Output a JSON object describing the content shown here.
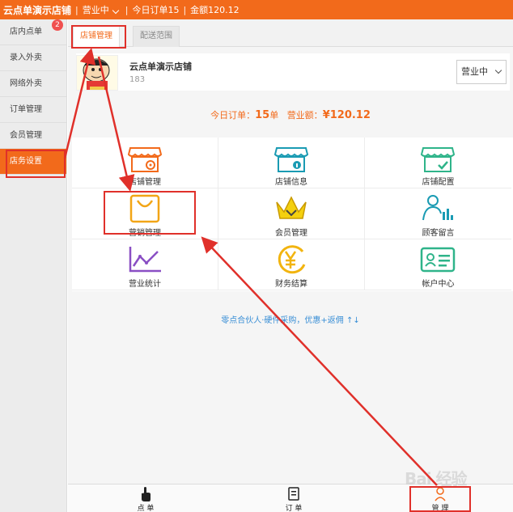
{
  "topbar": {
    "store_name": "云点单演示店铺",
    "sep1": "|",
    "status": "营业中",
    "sep2": "|",
    "orders": "今日订单15",
    "sep3": "|",
    "amount": "金额120.12"
  },
  "sidebar": {
    "badge": "2",
    "items": [
      {
        "label": "店内点单"
      },
      {
        "label": "录入外卖"
      },
      {
        "label": "网络外卖"
      },
      {
        "label": "订单管理"
      },
      {
        "label": "会员管理"
      },
      {
        "label": "店务设置"
      }
    ]
  },
  "tabs": [
    {
      "label": "店铺管理"
    },
    {
      "label": "配送范围"
    }
  ],
  "store": {
    "name": "云点单演示店铺",
    "phone": "183"
  },
  "status_select": {
    "value": "营业中"
  },
  "summary": {
    "orders_label": "今日订单：",
    "orders_value": "15",
    "orders_unit": "单",
    "sales_label": "营业额：",
    "sales_value": "¥120.12"
  },
  "menu": [
    {
      "label": "店铺管理",
      "icon": "store-settings-icon"
    },
    {
      "label": "店铺信息",
      "icon": "store-info-icon"
    },
    {
      "label": "店铺配置",
      "icon": "store-config-icon"
    },
    {
      "label": "营销管理",
      "icon": "marketing-bag-icon"
    },
    {
      "label": "会员管理",
      "icon": "crown-icon"
    },
    {
      "label": "顾客留言",
      "icon": "customer-message-icon"
    },
    {
      "label": "营业统计",
      "icon": "line-chart-icon"
    },
    {
      "label": "财务结算",
      "icon": "yen-coin-icon"
    },
    {
      "label": "帐户中心",
      "icon": "id-card-icon"
    }
  ],
  "promo": "零点合伙人·硬件采购，优惠+返佣 ↑↓",
  "bottom_nav": [
    {
      "label": "点 单",
      "icon": "touch-icon"
    },
    {
      "label": "订 单",
      "icon": "order-list-icon"
    },
    {
      "label": "管 理",
      "icon": "person-icon"
    }
  ],
  "watermark": "Bai 经验",
  "colors": {
    "primary": "#f26a1b",
    "annotation": "#e0302a",
    "link": "#3a8fd6"
  }
}
